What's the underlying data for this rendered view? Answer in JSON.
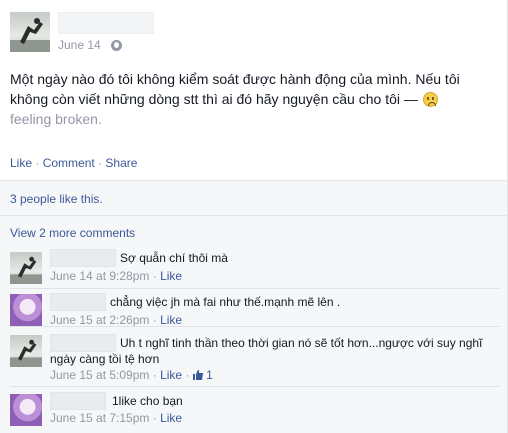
{
  "post": {
    "date": "June 14",
    "text": "Một ngày nào đó tôi không kiểm soát được hành động của mình. Nếu tôi không còn viết những dòng stt thì ai đó hãy nguyện cầu cho tôi — ",
    "feeling": "feeling broken.",
    "feeling_icon": "sad-face-icon",
    "privacy_icon": "globe-icon"
  },
  "actions": {
    "like": "Like",
    "comment": "Comment",
    "share": "Share",
    "sep": "·"
  },
  "likes": {
    "text": "3 people like this."
  },
  "view_more": "View 2 more comments",
  "comments": [
    {
      "text": "Sợ quẫn chí thôi mà",
      "time": "June 14 at 9:28pm",
      "like": "Like"
    },
    {
      "text": "chẳng việc jh mà fai như thế.mạnh mẽ lên .",
      "time": "June 15 at 2:26pm",
      "like": "Like"
    },
    {
      "text": "Uh t nghĩ tinh thần theo thời gian nó sẽ tốt hơn...ngược với suy nghĩ ngày càng tồi tệ hơn",
      "time": "June 15 at 5:09pm",
      "like": "Like",
      "like_count": "1"
    },
    {
      "text": "1like cho bạn",
      "time": "June 15 at 7:15pm",
      "like": "Like"
    }
  ],
  "colors": {
    "link": "#3b5998",
    "meta": "#9197a3",
    "text": "#141823"
  }
}
